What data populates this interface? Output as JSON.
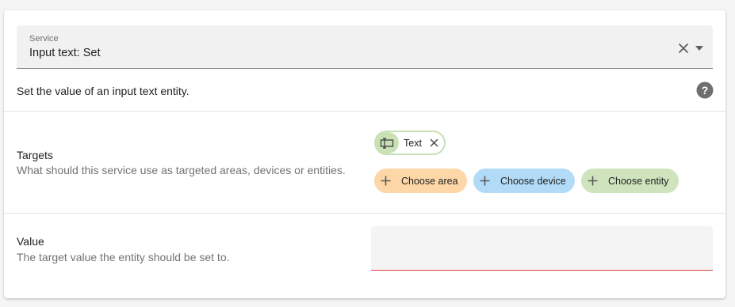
{
  "service": {
    "label": "Service",
    "value": "Input text: Set",
    "description": "Set the value of an input text entity."
  },
  "targets": {
    "title": "Targets",
    "subtitle": "What should this service use as targeted areas, devices or entities.",
    "selected_chip": "Text",
    "choose_area": "Choose area",
    "choose_device": "Choose device",
    "choose_entity": "Choose entity"
  },
  "value_field": {
    "title": "Value",
    "subtitle": "The target value the entity should be set to.",
    "input_value": ""
  },
  "icons": {
    "clear": "close-icon",
    "dropdown": "menu-down-icon",
    "help": "help-circle-icon",
    "entity": "form-textbox-icon",
    "remove": "close-icon",
    "add": "plus-icon"
  },
  "colors": {
    "area_chip": "#fdd7a7",
    "device_chip": "#b1dbf7",
    "entity_chip": "#cfe4bd",
    "error_underline": "#db4437"
  }
}
